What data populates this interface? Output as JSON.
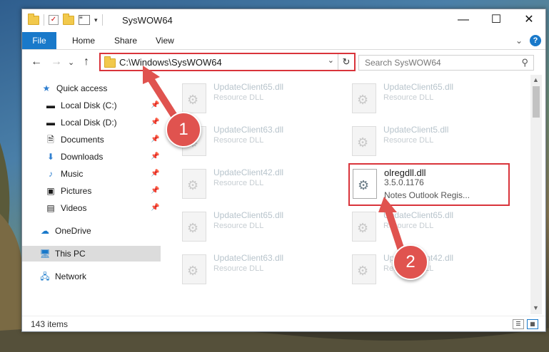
{
  "window": {
    "title": "SysWOW64",
    "minimize": "—",
    "maximize": "☐",
    "close": "✕"
  },
  "ribbon": {
    "tabs": [
      "File",
      "Home",
      "Share",
      "View"
    ],
    "expand": "⌄",
    "help": "?"
  },
  "nav": {
    "back": "←",
    "forward": "→",
    "recent": "⌄",
    "up": "↑",
    "address": "C:\\Windows\\SysWOW64",
    "address_dropdown": "⌄",
    "refresh": "↻",
    "search_placeholder": "Search SysWOW64"
  },
  "sidebar": {
    "items": [
      {
        "label": "Quick access",
        "icon": "star-icon"
      },
      {
        "label": "Local Disk (C:)",
        "icon": "drive-icon",
        "pinned": true
      },
      {
        "label": "Local Disk (D:)",
        "icon": "drive-icon",
        "pinned": true
      },
      {
        "label": "Documents",
        "icon": "documents-icon",
        "pinned": true
      },
      {
        "label": "Downloads",
        "icon": "downloads-icon",
        "pinned": true
      },
      {
        "label": "Music",
        "icon": "music-icon",
        "pinned": true
      },
      {
        "label": "Pictures",
        "icon": "pictures-icon",
        "pinned": true
      },
      {
        "label": "Videos",
        "icon": "videos-icon",
        "pinned": true
      },
      {
        "label": "OneDrive",
        "icon": "cloud-icon"
      },
      {
        "label": "This PC",
        "icon": "pc-icon",
        "selected": true
      },
      {
        "label": "Network",
        "icon": "network-icon"
      }
    ]
  },
  "files": [
    {
      "name": "UpdateClient65.dll",
      "type": "Resource DLL"
    },
    {
      "name": "UpdateClient65.dll",
      "type": "Resource DLL"
    },
    {
      "name": "UpdateClient63.dll",
      "type": "Resource DLL"
    },
    {
      "name": "UpdateClient5.dll",
      "type": "Resource DLL"
    },
    {
      "name": "UpdateClient42.dll",
      "type": "Resource DLL"
    },
    {
      "name": "olregdll.dll",
      "version": "3.5.0.1176",
      "description": "Notes Outlook Regis...",
      "highlighted": true
    },
    {
      "name": "UpdateClient65.dll",
      "type": "Resource DLL"
    },
    {
      "name": "UpdateClient65.dll",
      "type": "Resource DLL"
    },
    {
      "name": "UpdateClient63.dll",
      "type": "Resource DLL"
    },
    {
      "name": "UpdateClient42.dll",
      "type": "Resource DLL"
    }
  ],
  "status": {
    "items_count": "143 items"
  },
  "annotations": {
    "step1": "1",
    "step2": "2",
    "color": "#e0534f"
  }
}
